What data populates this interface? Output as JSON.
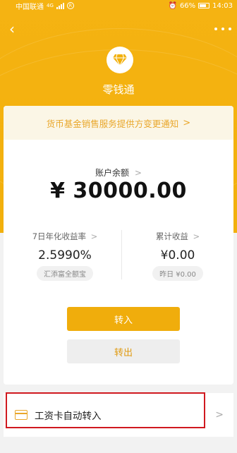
{
  "status_bar": {
    "carrier": "中国联通",
    "signal_label": "4G",
    "battery": "66%",
    "time": "14:03"
  },
  "header": {
    "title": "零钱通"
  },
  "notice": {
    "text": "货币基金销售服务提供方变更通知",
    "chevron": ">"
  },
  "balance": {
    "label": "账户余额",
    "chevron": ">",
    "amount": "¥ 30000.00"
  },
  "stats": {
    "yield_label": "7日年化收益率",
    "yield_value": "2.5990%",
    "yield_fund": "汇添富全额宝",
    "income_label": "累计收益",
    "income_value": "¥0.00",
    "income_yesterday": "昨日 ¥0.00",
    "chevron": ">"
  },
  "actions": {
    "transfer_in": "转入",
    "transfer_out": "转出"
  },
  "auto_transfer": {
    "label": "工资卡自动转入",
    "chevron": ">"
  },
  "colors": {
    "brand": "#f2b00c",
    "accent_text": "#e9a72b",
    "highlight_border": "#d0191f"
  }
}
